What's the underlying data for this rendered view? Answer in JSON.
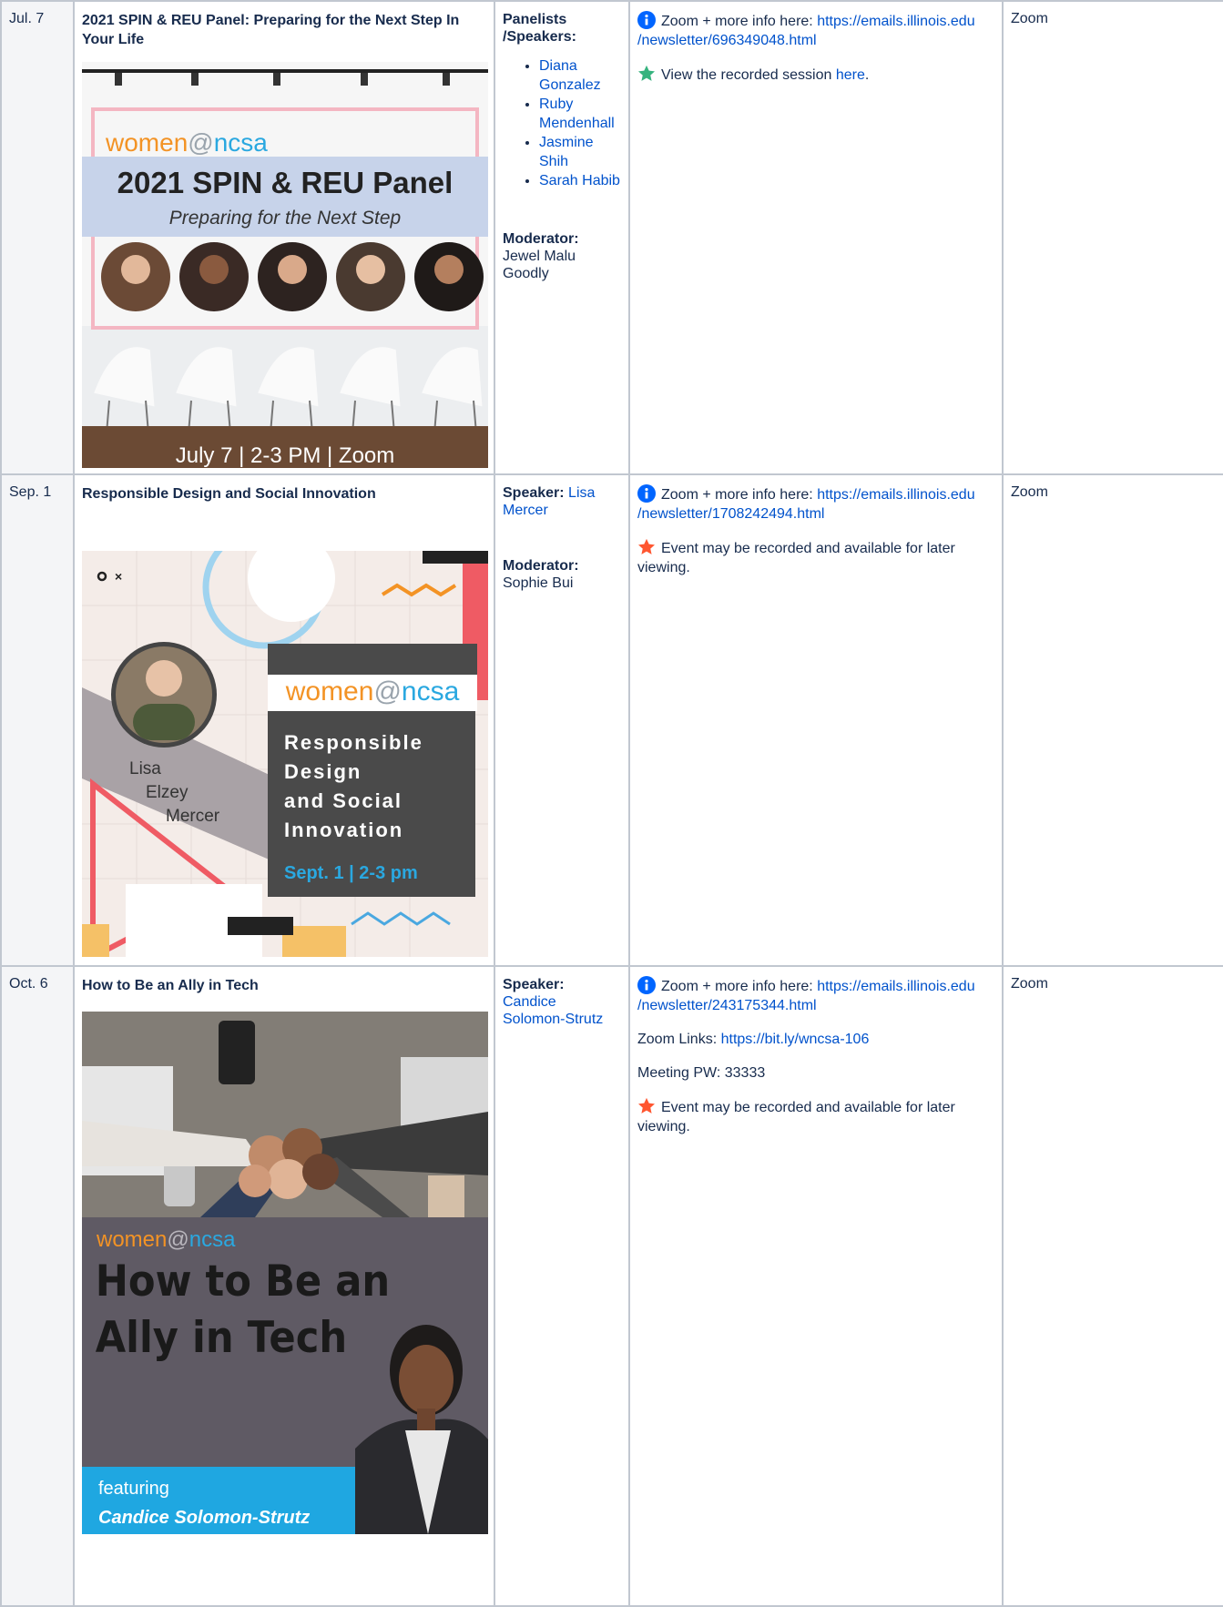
{
  "venue": "Zoom",
  "info_prefix": "Zoom + more info here: ",
  "events": [
    {
      "date": "Jul. 7",
      "title": "2021 SPIN & REU Panel: Preparing for the Next Step In Your Life",
      "poster": {
        "brand": "women@ncsa",
        "brand_left": "women",
        "brand_at": "@",
        "brand_right": "ncsa",
        "headline": "2021 SPIN & REU Panel",
        "subline": "Preparing for the Next Step",
        "footer": "July 7 | 2-3 PM | Zoom"
      },
      "panelists_label": "Panelists /Speakers:",
      "panelists": [
        "Diana Gonzalez",
        "Ruby Mendenhall",
        "Jasmine Shih",
        "Sarah Habib"
      ],
      "moderator_label": "Moderator:",
      "moderator": "Jewel Malu Goodly",
      "info_url_1": "https://emails.illinois.edu",
      "info_url_2": "/newsletter/696349048.html",
      "recorded_text": "View the recorded session ",
      "recorded_link": "here",
      "recorded_end": "."
    },
    {
      "date": "Sep. 1",
      "title": "Responsible Design and Social Innovation",
      "poster": {
        "brand_left": "women",
        "brand_at": "@",
        "brand_right": "ncsa",
        "name_1": "Lisa",
        "name_2": "Elzey",
        "name_3": "Mercer",
        "l1": "Responsible",
        "l2": "Design",
        "l3": "and Social",
        "l4": "Innovation",
        "when": "Sept. 1 | 2-3 pm"
      },
      "speaker_label": "Speaker:",
      "speaker": "Lisa Mercer",
      "moderator_label": "Moderator:",
      "moderator": "Sophie Bui",
      "info_url_1": "https://emails.illinois.edu",
      "info_url_2": "/newsletter/1708242494.html",
      "note": "Event may be recorded and available for later viewing."
    },
    {
      "date": "Oct. 6",
      "title": "How to Be an Ally in Tech",
      "poster": {
        "brand_left": "women",
        "brand_at": "@",
        "brand_right": "ncsa",
        "h1": "How to Be an",
        "h2": "Ally in Tech",
        "featuring": "featuring",
        "name": "Candice Solomon-Strutz"
      },
      "speaker_label": "Speaker:",
      "speaker": "Candice Solomon-Strutz",
      "info_url_1": "https://emails.illinois.edu",
      "info_url_2": "/newsletter/243175344.html",
      "zoom_links_label": "Zoom Links: ",
      "zoom_links": "https://bit.ly/wncsa-106",
      "meeting_pw": "Meeting PW: 33333",
      "note": "Event may be recorded and available for later viewing."
    }
  ],
  "colors": {
    "link": "#0052cc",
    "info_icon": "#0065ff",
    "success_star": "#36b37e",
    "note_star": "#ff5630",
    "border": "#c1c7d0"
  },
  "icons": [
    "info-icon",
    "green-star-icon",
    "orange-star-icon"
  ]
}
